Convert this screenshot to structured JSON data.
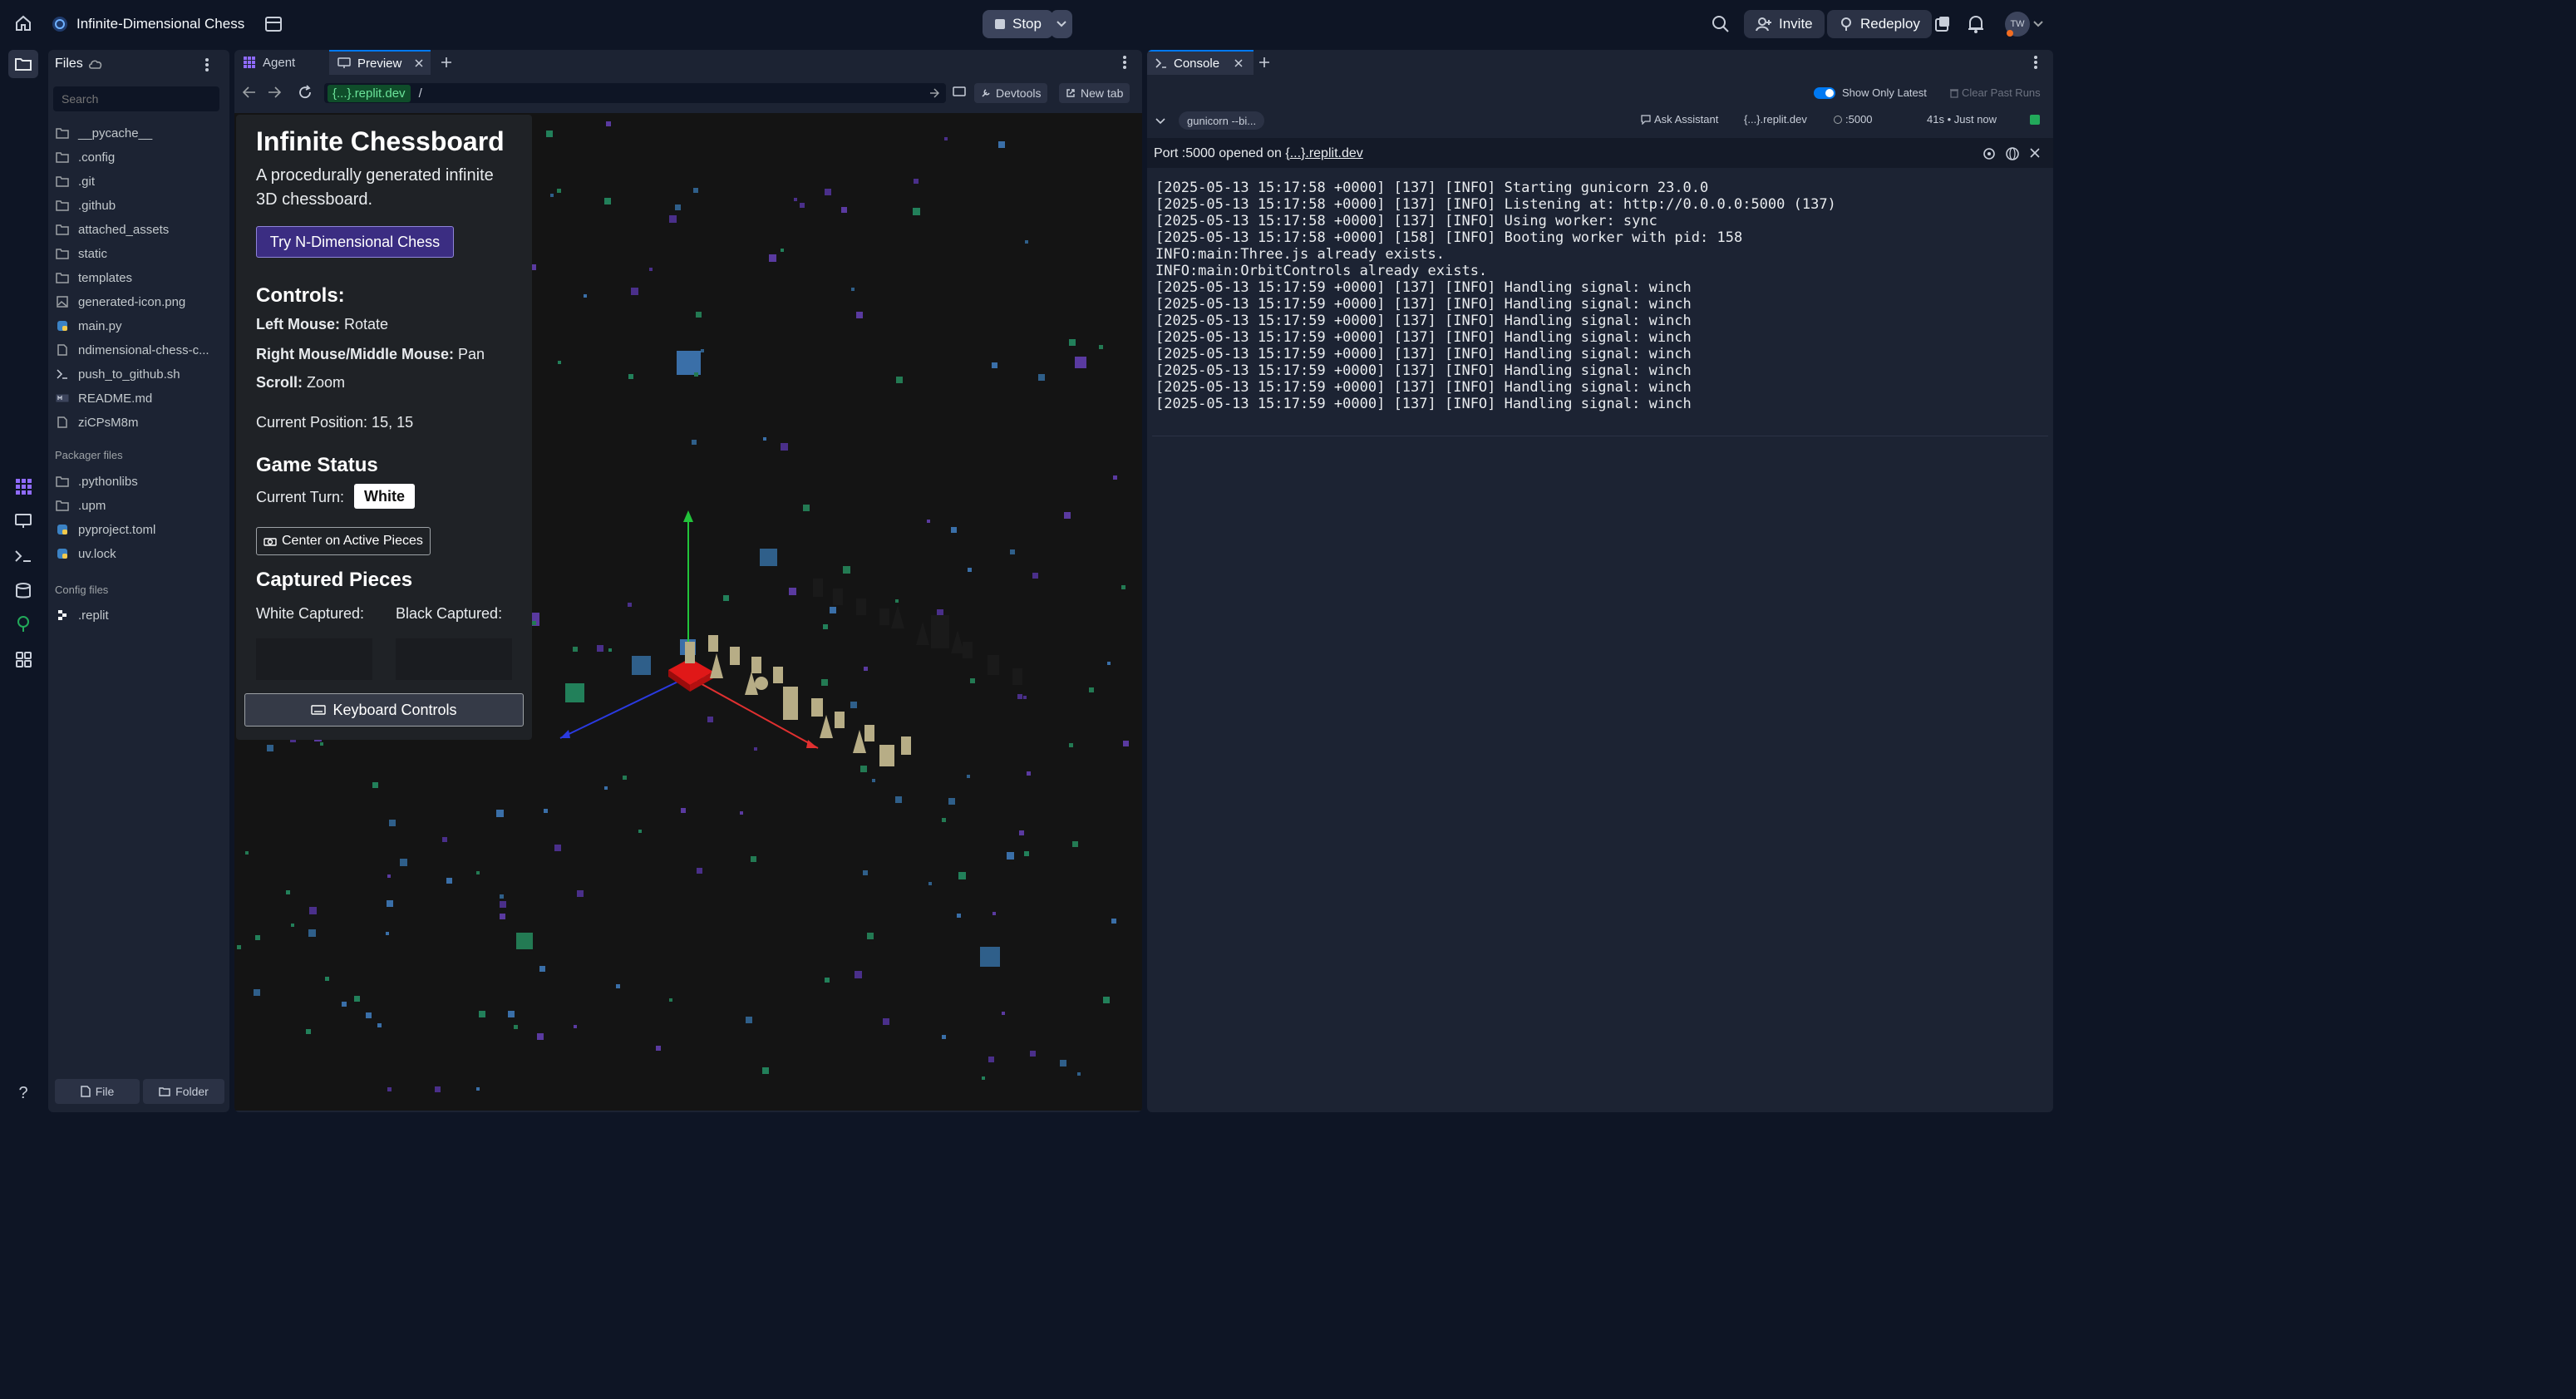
{
  "topbar": {
    "project_title": "Infinite-Dimensional Chess",
    "stop_label": "Stop",
    "invite_label": "Invite",
    "redeploy_label": "Redeploy",
    "avatar_initials": "TW"
  },
  "files_panel": {
    "title": "Files",
    "search_placeholder": "Search",
    "items": [
      {
        "name": "__pycache__",
        "type": "folder"
      },
      {
        "name": ".config",
        "type": "folder"
      },
      {
        "name": ".git",
        "type": "folder"
      },
      {
        "name": ".github",
        "type": "folder"
      },
      {
        "name": "attached_assets",
        "type": "folder"
      },
      {
        "name": "static",
        "type": "folder"
      },
      {
        "name": "templates",
        "type": "folder"
      },
      {
        "name": "generated-icon.png",
        "type": "image"
      },
      {
        "name": "main.py",
        "type": "python"
      },
      {
        "name": "ndimensional-chess-c...",
        "type": "file"
      },
      {
        "name": "push_to_github.sh",
        "type": "shell"
      },
      {
        "name": "README.md",
        "type": "markdown"
      },
      {
        "name": "ziCPsM8m",
        "type": "file"
      }
    ],
    "packager_label": "Packager files",
    "packager_items": [
      {
        "name": ".pythonlibs",
        "type": "folder"
      },
      {
        "name": ".upm",
        "type": "folder"
      },
      {
        "name": "pyproject.toml",
        "type": "python"
      },
      {
        "name": "uv.lock",
        "type": "python"
      }
    ],
    "config_label": "Config files",
    "config_items": [
      {
        "name": ".replit",
        "type": "replit"
      }
    ],
    "new_file_label": "File",
    "new_folder_label": "Folder"
  },
  "preview": {
    "tab_agent": "Agent",
    "tab_preview": "Preview",
    "url_host": "{...}.replit.dev",
    "url_path": "/",
    "devtools_label": "Devtools",
    "newtab_label": "New tab",
    "overlay": {
      "title": "Infinite Chessboard",
      "subtitle_line1": "A procedurally generated infinite",
      "subtitle_line2": "3D chessboard.",
      "try_button": "Try N-Dimensional Chess",
      "controls_heading": "Controls:",
      "control1_key": "Left Mouse:",
      "control1_val": "Rotate",
      "control2_key": "Right Mouse/Middle Mouse:",
      "control2_val": "Pan",
      "control3_key": "Scroll:",
      "control3_val": "Zoom",
      "position": "Current Position: 15, 15",
      "status_heading": "Game Status",
      "turn_label": "Current Turn:",
      "turn_value": "White",
      "center_button": "Center on Active Pieces",
      "captured_heading": "Captured Pieces",
      "white_captured": "White Captured:",
      "black_captured": "Black Captured:",
      "keyboard_button": "Keyboard Controls"
    }
  },
  "console": {
    "tab_label": "Console",
    "show_only_latest": "Show Only Latest",
    "clear_past_runs": "Clear Past Runs",
    "run_name": "gunicorn --bi...",
    "ask_assistant": "Ask Assistant",
    "host": "{...}.replit.dev",
    "port": ":5000",
    "run_time": "41s • Just now",
    "port_notice_prefix": "Port :5000 opened on ",
    "port_notice_link": "{...}.replit.dev",
    "log_lines": [
      "[2025-05-13 15:17:58 +0000] [137] [INFO] Starting gunicorn 23.0.0",
      "[2025-05-13 15:17:58 +0000] [137] [INFO] Listening at: http://0.0.0.0:5000 (137)",
      "[2025-05-13 15:17:58 +0000] [137] [INFO] Using worker: sync",
      "[2025-05-13 15:17:58 +0000] [158] [INFO] Booting worker with pid: 158",
      "INFO:main:Three.js already exists.",
      "INFO:main:OrbitControls already exists.",
      "[2025-05-13 15:17:59 +0000] [137] [INFO] Handling signal: winch",
      "[2025-05-13 15:17:59 +0000] [137] [INFO] Handling signal: winch",
      "[2025-05-13 15:17:59 +0000] [137] [INFO] Handling signal: winch",
      "[2025-05-13 15:17:59 +0000] [137] [INFO] Handling signal: winch",
      "[2025-05-13 15:17:59 +0000] [137] [INFO] Handling signal: winch",
      "[2025-05-13 15:17:59 +0000] [137] [INFO] Handling signal: winch",
      "[2025-05-13 15:17:59 +0000] [137] [INFO] Handling signal: winch",
      "[2025-05-13 15:17:59 +0000] [137] [INFO] Handling signal: winch"
    ]
  },
  "colors": {
    "accent_blue": "#0079f2",
    "run_green": "#22a95a",
    "surface": "#1c2333",
    "background": "#0e1525"
  }
}
